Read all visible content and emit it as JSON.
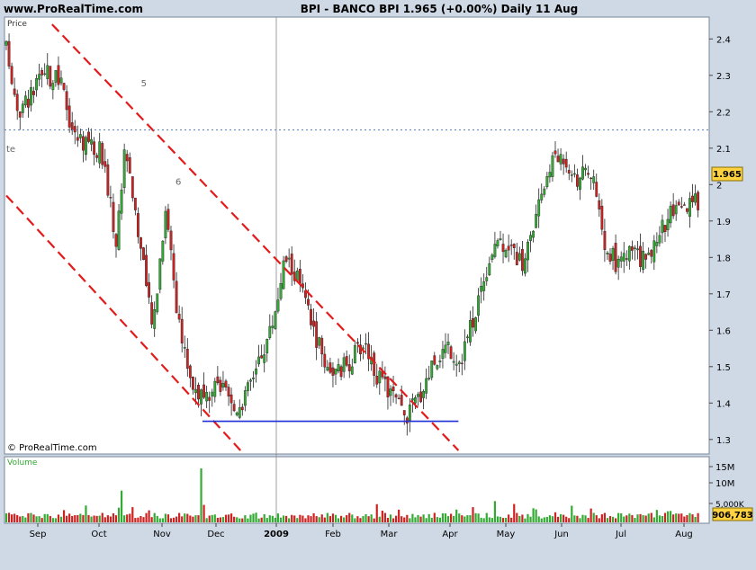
{
  "header": {
    "site": "www.ProRealTime.com",
    "title": "BPI - BANCO BPI    1.965 (+0.00%)    Daily  11 Aug"
  },
  "footer_note": "© ProRealTime.com",
  "chart_data": [
    {
      "type": "candlestick",
      "panel": "price",
      "title": "Price",
      "y_ticks": [
        1.3,
        1.4,
        1.5,
        1.6,
        1.7,
        1.8,
        1.9,
        2,
        2.1,
        2.2,
        2.3,
        2.4
      ],
      "ylim": [
        1.26,
        2.46
      ],
      "last_value_label": "1.965",
      "x_labels": [
        {
          "label": "Sep",
          "date": "2008-09-01"
        },
        {
          "label": "Oct",
          "date": "2008-10-01"
        },
        {
          "label": "Nov",
          "date": "2008-11-03"
        },
        {
          "label": "Dec",
          "date": "2008-12-01"
        },
        {
          "label": "2009",
          "date": "2009-01-02"
        },
        {
          "label": "Feb",
          "date": "2009-02-02"
        },
        {
          "label": "Mar",
          "date": "2009-03-02"
        },
        {
          "label": "Apr",
          "date": "2009-04-01"
        },
        {
          "label": "May",
          "date": "2009-05-04"
        },
        {
          "label": "Jun",
          "date": "2009-06-01"
        },
        {
          "label": "Jul",
          "date": "2009-07-01"
        },
        {
          "label": "Aug",
          "date": "2009-08-03"
        }
      ],
      "close_path": [
        [
          "2008-08-12",
          2.37
        ],
        [
          "2008-08-20",
          2.2
        ],
        [
          "2008-08-28",
          2.25
        ],
        [
          "2008-09-05",
          2.3
        ],
        [
          "2008-09-12",
          2.28
        ],
        [
          "2008-09-19",
          2.13
        ],
        [
          "2008-09-26",
          2.12
        ],
        [
          "2008-10-03",
          2.08
        ],
        [
          "2008-10-10",
          1.84
        ],
        [
          "2008-10-15",
          2.12
        ],
        [
          "2008-10-22",
          1.85
        ],
        [
          "2008-10-29",
          1.6
        ],
        [
          "2008-11-05",
          1.95
        ],
        [
          "2008-11-12",
          1.6
        ],
        [
          "2008-11-19",
          1.45
        ],
        [
          "2008-11-26",
          1.4
        ],
        [
          "2008-12-03",
          1.45
        ],
        [
          "2008-12-10",
          1.38
        ],
        [
          "2008-12-17",
          1.42
        ],
        [
          "2008-12-22",
          1.5
        ],
        [
          "2008-12-30",
          1.6
        ],
        [
          "2009-01-07",
          1.8
        ],
        [
          "2009-01-14",
          1.74
        ],
        [
          "2009-01-21",
          1.62
        ],
        [
          "2009-01-28",
          1.52
        ],
        [
          "2009-02-04",
          1.48
        ],
        [
          "2009-02-11",
          1.52
        ],
        [
          "2009-02-18",
          1.57
        ],
        [
          "2009-02-25",
          1.46
        ],
        [
          "2009-03-04",
          1.42
        ],
        [
          "2009-03-10",
          1.36
        ],
        [
          "2009-03-17",
          1.42
        ],
        [
          "2009-03-24",
          1.52
        ],
        [
          "2009-03-31",
          1.56
        ],
        [
          "2009-04-07",
          1.52
        ],
        [
          "2009-04-14",
          1.62
        ],
        [
          "2009-04-21",
          1.75
        ],
        [
          "2009-04-28",
          1.85
        ],
        [
          "2009-05-05",
          1.84
        ],
        [
          "2009-05-12",
          1.78
        ],
        [
          "2009-05-19",
          1.9
        ],
        [
          "2009-05-26",
          2.06
        ],
        [
          "2009-06-02",
          2.08
        ],
        [
          "2009-06-09",
          2.02
        ],
        [
          "2009-06-16",
          2.03
        ],
        [
          "2009-06-23",
          1.82
        ],
        [
          "2009-06-30",
          1.78
        ],
        [
          "2009-07-07",
          1.82
        ],
        [
          "2009-07-14",
          1.78
        ],
        [
          "2009-07-21",
          1.88
        ],
        [
          "2009-07-28",
          1.92
        ],
        [
          "2009-08-04",
          1.93
        ],
        [
          "2009-08-11",
          1.965
        ]
      ],
      "channel_lines": [
        {
          "from": [
            "2008-09-08",
            2.44
          ],
          "to": [
            "2009-04-06",
            1.27
          ]
        },
        {
          "from": [
            "2008-08-12",
            1.97
          ],
          "to": [
            "2008-12-14",
            1.27
          ]
        }
      ],
      "horizontal_lines": [
        {
          "y": 2.15,
          "style": "dotted"
        },
        {
          "y": 1.35,
          "from": "2008-11-24",
          "to": "2009-04-06"
        }
      ],
      "annotations": [
        {
          "text": "5",
          "x": "2008-10-23",
          "y": 2.27
        },
        {
          "text": "6",
          "x": "2008-11-10",
          "y": 2.0
        },
        {
          "text": "te",
          "x": "2008-08-12",
          "y": 2.09
        }
      ],
      "colors": {
        "up": "#33aa33",
        "down": "#cc2222",
        "channel": "#e31b1b",
        "support": "#1f2fd6"
      }
    },
    {
      "type": "bar",
      "panel": "volume",
      "title": "Volume",
      "y_ticks": [
        "15M",
        "10M",
        "5,000K"
      ],
      "last_value_label": "906,783",
      "peaks": [
        {
          "x": "2008-10-13",
          "value": 10000000
        },
        {
          "x": "2008-11-24",
          "value": 17000000
        }
      ],
      "colors": {
        "up": "#33aa33",
        "down": "#cc2222"
      }
    }
  ]
}
